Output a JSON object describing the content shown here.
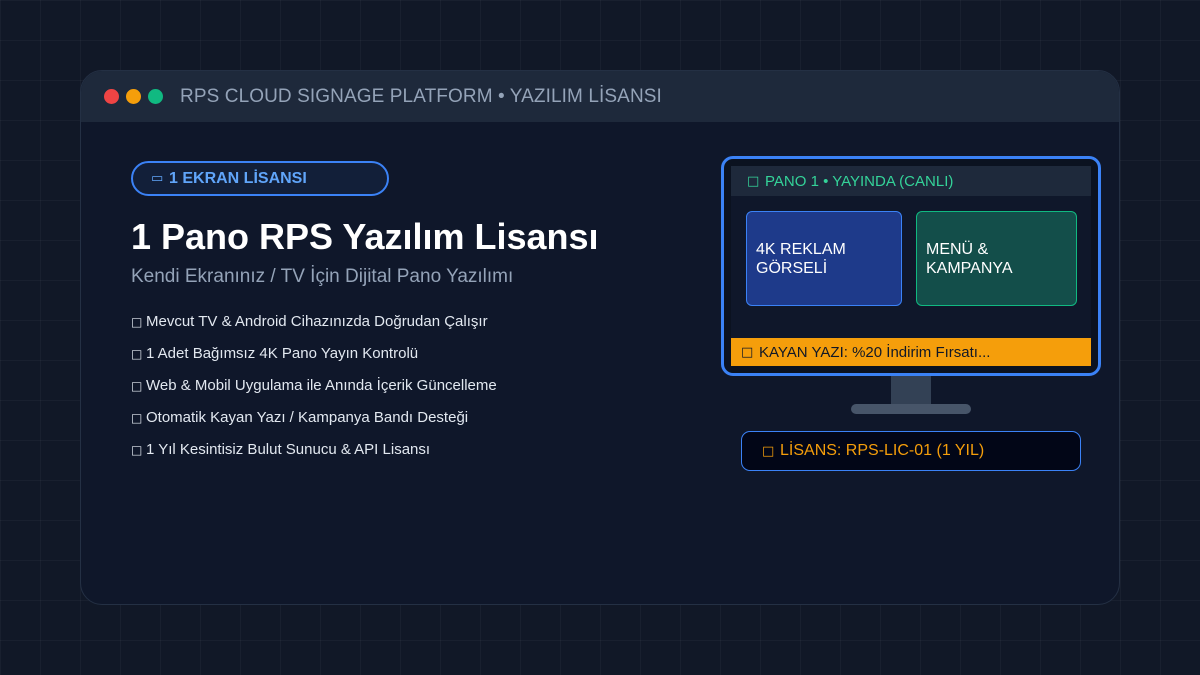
{
  "window": {
    "title": "RPS CLOUD SIGNAGE PLATFORM • YAZILIM LİSANSI",
    "controls": [
      {
        "name": "close",
        "color": "#ef4444"
      },
      {
        "name": "minimize",
        "color": "#f59e0b"
      },
      {
        "name": "maximize",
        "color": "#10b981"
      }
    ]
  },
  "product": {
    "badge_icon": "screen-icon",
    "badge_label": "1 EKRAN LİSANSI",
    "title": "1 Pano RPS Yazılım Lisansı",
    "subtitle": "Kendi Ekranınız / TV İçin Dijital Pano Yazılımı",
    "features": [
      "Mevcut TV & Android Cihazınızda Doğrudan Çalışır",
      "1 Adet Bağımsız 4K Pano Yayın Kontrolü",
      "Web & Mobil Uygulama ile Anında İçerik Güncelleme",
      "Otomatik Kayan Yazı / Kampanya Bandı Desteği",
      "1 Yıl Kesintisiz Bulut Sunucu & API Lisansı"
    ],
    "feature_icon": "check-icon"
  },
  "preview": {
    "status": "PANO 1 • YAYINDA (CANLI)",
    "status_icon": "live-dot-icon",
    "tiles": [
      {
        "label": "4K REKLAM GÖRSELİ",
        "color": "#1e3a8a"
      },
      {
        "label": "MENÜ & KAMPANYA",
        "color": "#134e4a"
      }
    ],
    "ticker_icon": "megaphone-icon",
    "ticker": "KAYAN YAZI: %20 İndirim Fırsatı...",
    "accent": "#3b82f6"
  },
  "license": {
    "icon": "key-icon",
    "label": "LİSANS: RPS-LIC-01 (1 YIL)"
  }
}
